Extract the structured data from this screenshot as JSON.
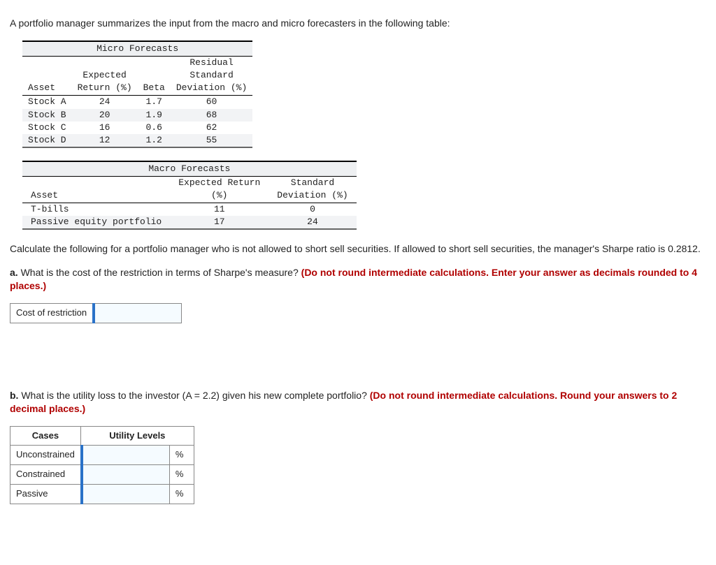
{
  "intro": "A portfolio manager summarizes the input from the macro and micro forecasters in the following table:",
  "micro": {
    "title": "Micro Forecasts",
    "headers": {
      "asset": "Asset",
      "expected": "Expected\nReturn (%)",
      "beta": "Beta",
      "residual": "Residual\nStandard\nDeviation (%)"
    },
    "rows": [
      {
        "asset": "Stock A",
        "ret": "24",
        "beta": "1.7",
        "rsd": "60"
      },
      {
        "asset": "Stock B",
        "ret": "20",
        "beta": "1.9",
        "rsd": "68"
      },
      {
        "asset": "Stock C",
        "ret": "16",
        "beta": "0.6",
        "rsd": "62"
      },
      {
        "asset": "Stock D",
        "ret": "12",
        "beta": "1.2",
        "rsd": "55"
      }
    ]
  },
  "macro": {
    "title": "Macro Forecasts",
    "headers": {
      "asset": "Asset",
      "expected": "Expected Return\n(%)",
      "sd": "Standard\nDeviation (%)"
    },
    "rows": [
      {
        "asset": "T-bills",
        "ret": "11",
        "sd": "0"
      },
      {
        "asset": "Passive equity portfolio",
        "ret": "17",
        "sd": "24"
      }
    ]
  },
  "calc_text": "Calculate the following for a portfolio manager who is not allowed to short sell securities. If allowed to short sell securities, the manager's Sharpe ratio is 0.2812.",
  "qa": {
    "prefix": "a.",
    "text": " What is the cost of the restriction in terms of Sharpe's measure? ",
    "red": "(Do not round intermediate calculations. Enter your answer as decimals rounded to 4 places.)"
  },
  "cost_label": "Cost of restriction",
  "qb": {
    "prefix": "b.",
    "text": " What is the utility loss to the investor (A = 2.2) given his new complete portfolio? ",
    "red": "(Do not round intermediate calculations. Round your answers to 2 decimal places.)"
  },
  "utility_table": {
    "cases_hdr": "Cases",
    "levels_hdr": "Utility Levels",
    "rows": [
      "Unconstrained",
      "Constrained",
      "Passive"
    ],
    "suffix": "%"
  }
}
